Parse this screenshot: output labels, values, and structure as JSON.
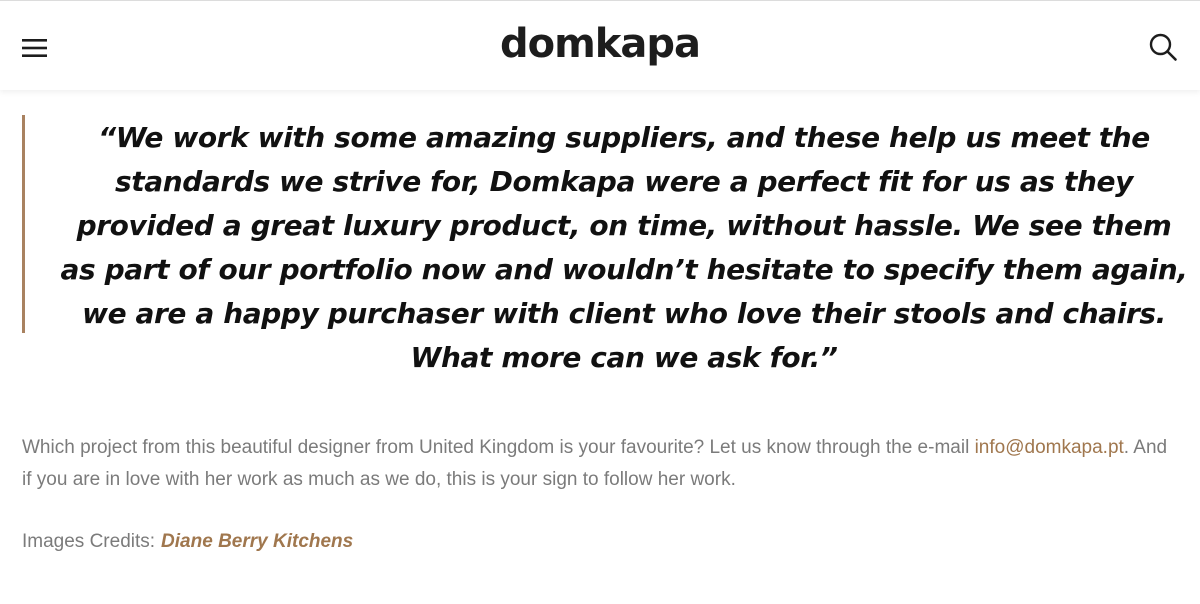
{
  "header": {
    "logo_text": "domkapa",
    "menu_icon": "hamburger-menu-icon",
    "search_icon": "search-icon"
  },
  "quote": {
    "text": "“We work with some amazing suppliers, and these help us meet the standards we strive for, Domkapa were a perfect fit for us as they provided a great luxury product, on time, without hassle. We see them as part of our portfolio now and wouldn’t hesitate to specify them again, we are a happy purchaser with client who love their stools and chairs. What more can we ask for.”",
    "accent_color": "#a98260"
  },
  "body": {
    "text_before": "Which project from this beautiful designer from United Kingdom is your favourite? Let us know through the e-mail ",
    "email": "info@domkapa.pt",
    "text_after": ". And if you are in love with her work as much as we do, this is your sign to follow her work."
  },
  "credits": {
    "label": "Images Credits:",
    "link_text": "Diane Berry Kitchens"
  },
  "colors": {
    "link": "#a0774e",
    "body_text": "#7b7b7b",
    "heading_text": "#111111"
  }
}
